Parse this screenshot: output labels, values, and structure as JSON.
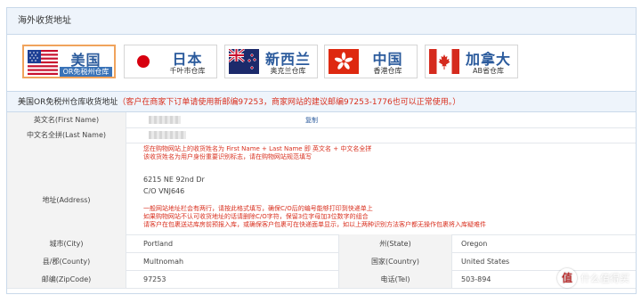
{
  "section": {
    "title": "海外收货地址"
  },
  "tabs": [
    {
      "cn": "美国",
      "sub": "OR免税州仓库",
      "flag": "usa-flag-icon",
      "active": true
    },
    {
      "cn": "日本",
      "sub": "千叶市仓库",
      "flag": "japan-flag-icon",
      "active": false
    },
    {
      "cn": "新西兰",
      "sub": "奥克兰仓库",
      "flag": "new-zealand-flag-icon",
      "active": false
    },
    {
      "cn": "中国",
      "sub": "香港仓库",
      "flag": "hong-kong-flag-icon",
      "active": false
    },
    {
      "cn": "加拿大",
      "sub": "AB省仓库",
      "flag": "canada-flag-icon",
      "active": false
    }
  ],
  "subheader": {
    "title": "美国OR免税州仓库收货地址",
    "note": "（客户在商家下订单请使用新邮编97253，商家网站的建议邮编97253-1776也可以正常使用。）"
  },
  "rows": {
    "english_name": {
      "label": "英文名(First Name)",
      "copy": "复制"
    },
    "pinyin_name": {
      "label": "中文名全拼(Last Name)"
    },
    "name_hint": [
      "您在购物网站上的收货姓名为 First Name + Last Name 即 英文名 + 中文名全拼",
      "该收货姓名为用户身份重要识别标志，请在购物网站规范填写"
    ],
    "address": {
      "label": "地址(Address)",
      "line1": "6215 NE 92nd Dr",
      "line2": "C/O VNJ646"
    },
    "address_hint": [
      "一般网站地址栏会有两行，请按此格式填写，确保C/O后的编号能够打印到快递单上",
      "如果购物网站不认可收货地址的话请删除C/O字符，保留3位字母加3位数字的组合",
      "请客户在包裹送达库房前预报入库，或确保客户包裹可在快递面单显示，如以上两种识别方法客户都无操作包裹将入库疑难件"
    ],
    "city": {
      "label": "城市(City)",
      "value": "Portland"
    },
    "state": {
      "label": "州(State)",
      "value": "Oregon"
    },
    "county": {
      "label": "县/郡(County)",
      "value": "Multnomah"
    },
    "country": {
      "label": "国家(Country)",
      "value": "United States"
    },
    "zip": {
      "label": "邮编(ZipCode)",
      "value": "97253"
    },
    "tel": {
      "label": "电话(Tel)",
      "value": "503-894"
    }
  },
  "watermark": {
    "glyph": "值",
    "text": "什么值得买"
  },
  "colors": {
    "accent": "#2a5a9c",
    "warning": "#d9301f",
    "active_border": "#f0a35c",
    "header_bg": "#eef4fb"
  }
}
